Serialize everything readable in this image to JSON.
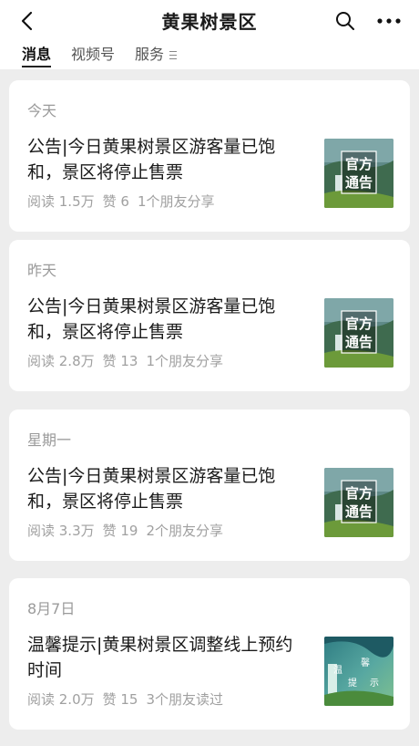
{
  "header": {
    "title": "黄果树景区"
  },
  "tabs": [
    {
      "label": "消息"
    },
    {
      "label": "视频号"
    },
    {
      "label": "服务"
    }
  ],
  "articles": [
    {
      "date": "今天",
      "headline": "公告|今日黄果树景区游客量已饱和，景区将停止售票",
      "reads": "阅读 1.5万",
      "likes": "赞 6",
      "friends": "1个朋友分享",
      "thumb_text": [
        "官方",
        "通告"
      ]
    },
    {
      "date": "昨天",
      "headline": "公告|今日黄果树景区游客量已饱和，景区将停止售票",
      "reads": "阅读 2.8万",
      "likes": "赞 13",
      "friends": "1个朋友分享",
      "thumb_text": [
        "官方",
        "通告"
      ]
    },
    {
      "date": "星期一",
      "headline": "公告|今日黄果树景区游客量已饱和，景区将停止售票",
      "reads": "阅读 3.3万",
      "likes": "赞 19",
      "friends": "2个朋友分享",
      "thumb_text": [
        "官方",
        "通告"
      ]
    },
    {
      "date": "8月7日",
      "headline": "温馨提示|黄果树景区调整线上预约时间",
      "reads": "阅读 2.0万",
      "likes": "赞 15",
      "friends": "3个朋友读过",
      "thumb_text": [
        "温",
        "馨",
        "提",
        "示"
      ]
    }
  ],
  "icons": {
    "back": "chevron-left-icon",
    "search": "search-icon",
    "more": "more-dots-icon",
    "menu": "menu-lines-icon"
  }
}
